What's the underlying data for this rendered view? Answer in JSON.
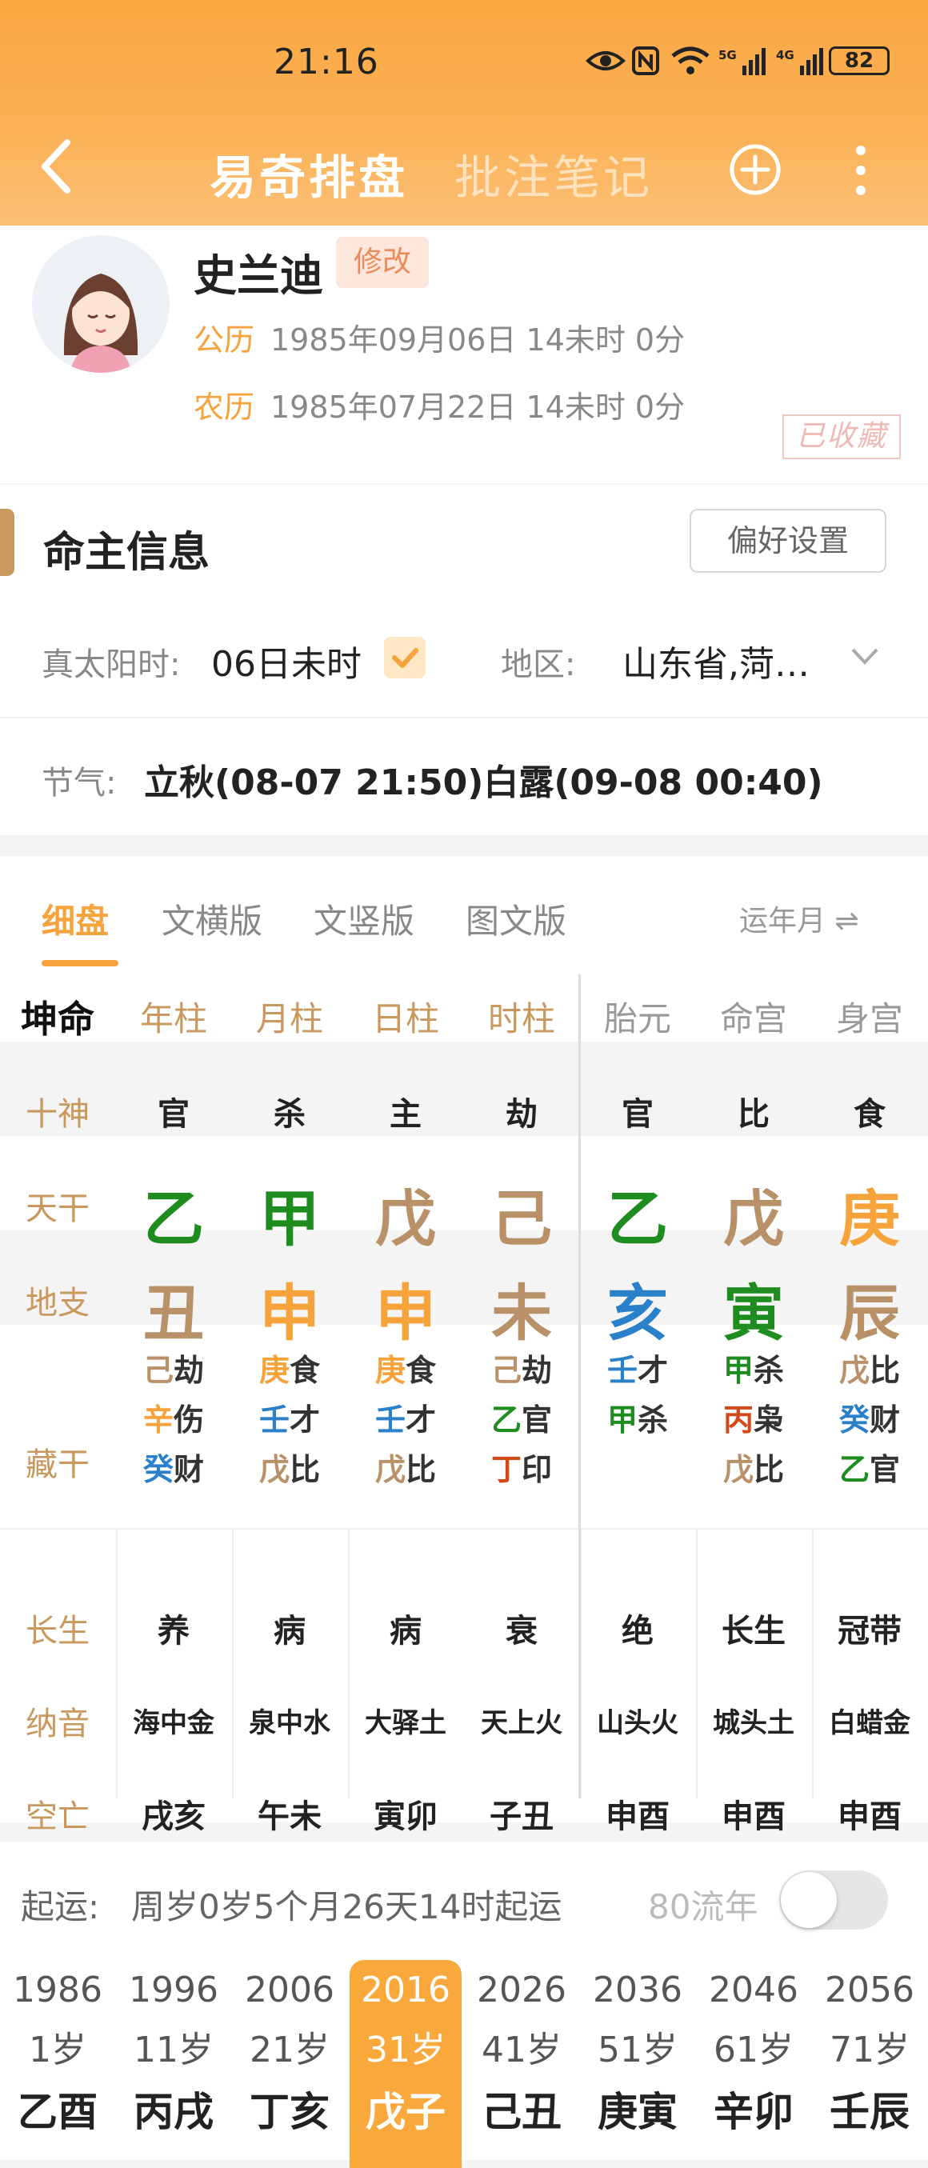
{
  "status": {
    "time": "21:16",
    "signal1": "5G",
    "signal2": "4G",
    "battery": "82"
  },
  "nav": {
    "title": "易奇排盘",
    "notes": "批注笔记"
  },
  "profile": {
    "name": "史兰迪",
    "edit": "修改",
    "solar_label": "公历",
    "solar": "1985年09月06日 14未时 0分",
    "lunar_label": "农历",
    "lunar": "1985年07月22日 14未时 0分",
    "stamp": "已收藏"
  },
  "info": {
    "title": "命主信息",
    "pref": "偏好设置",
    "sun_label": "真太阳时:",
    "sun_value": "06日未时",
    "region_label": "地区:",
    "region_value": "山东省,菏…",
    "jieqi_label": "节气:",
    "jieqi_value": "立秋(08-07 21:50)白露(09-08 00:40)"
  },
  "tabs": {
    "items": [
      "细盘",
      "文横版",
      "文竖版",
      "图文版"
    ],
    "active": 0,
    "right": "运年月 ⇌"
  },
  "colors": {
    "accent": "#f5a33a",
    "gold": "#c9985e",
    "wood": "#1e8c1e",
    "metal": "#f5a33a",
    "earth": "#b99168",
    "water": "#2a80c9",
    "fire": "#d24a1a"
  },
  "chart": {
    "gender": "坤命",
    "headers": [
      "年柱",
      "月柱",
      "日柱",
      "时柱",
      "胎元",
      "命宫",
      "身宫"
    ],
    "row_labels": [
      "十神",
      "天干",
      "地支",
      "藏干",
      "长生",
      "纳音",
      "空亡"
    ],
    "shishen": [
      "官",
      "杀",
      "主",
      "劫",
      "官",
      "比",
      "食"
    ],
    "tiangan": [
      {
        "c": "乙",
        "color": "#1e8c1e"
      },
      {
        "c": "甲",
        "color": "#1e8c1e"
      },
      {
        "c": "戊",
        "color": "#b99168"
      },
      {
        "c": "己",
        "color": "#b99168"
      },
      {
        "c": "乙",
        "color": "#1e8c1e"
      },
      {
        "c": "戊",
        "color": "#b99168"
      },
      {
        "c": "庚",
        "color": "#f5a33a"
      }
    ],
    "dizhi": [
      {
        "c": "丑",
        "color": "#b99168"
      },
      {
        "c": "申",
        "color": "#f5a33a"
      },
      {
        "c": "申",
        "color": "#f5a33a"
      },
      {
        "c": "未",
        "color": "#b99168"
      },
      {
        "c": "亥",
        "color": "#2a80c9"
      },
      {
        "c": "寅",
        "color": "#1e8c1e"
      },
      {
        "c": "辰",
        "color": "#b99168"
      }
    ],
    "canggan": [
      [
        {
          "g": "己",
          "color": "#b99168",
          "s": "劫"
        },
        {
          "g": "辛",
          "color": "#f5a33a",
          "s": "伤"
        },
        {
          "g": "癸",
          "color": "#2a80c9",
          "s": "财"
        }
      ],
      [
        {
          "g": "庚",
          "color": "#f5a33a",
          "s": "食"
        },
        {
          "g": "壬",
          "color": "#2a80c9",
          "s": "才"
        },
        {
          "g": "戊",
          "color": "#b99168",
          "s": "比"
        }
      ],
      [
        {
          "g": "庚",
          "color": "#f5a33a",
          "s": "食"
        },
        {
          "g": "壬",
          "color": "#2a80c9",
          "s": "才"
        },
        {
          "g": "戊",
          "color": "#b99168",
          "s": "比"
        }
      ],
      [
        {
          "g": "己",
          "color": "#b99168",
          "s": "劫"
        },
        {
          "g": "乙",
          "color": "#1e8c1e",
          "s": "官"
        },
        {
          "g": "丁",
          "color": "#d24a1a",
          "s": "印"
        }
      ],
      [
        {
          "g": "壬",
          "color": "#2a80c9",
          "s": "才"
        },
        {
          "g": "甲",
          "color": "#1e8c1e",
          "s": "杀"
        }
      ],
      [
        {
          "g": "甲",
          "color": "#1e8c1e",
          "s": "杀"
        },
        {
          "g": "丙",
          "color": "#d24a1a",
          "s": "枭"
        },
        {
          "g": "戊",
          "color": "#b99168",
          "s": "比"
        }
      ],
      [
        {
          "g": "戊",
          "color": "#b99168",
          "s": "比"
        },
        {
          "g": "癸",
          "color": "#2a80c9",
          "s": "财"
        },
        {
          "g": "乙",
          "color": "#1e8c1e",
          "s": "官"
        }
      ]
    ],
    "changsheng": [
      "养",
      "病",
      "病",
      "衰",
      "绝",
      "长生",
      "冠带"
    ],
    "nayin": [
      "海中金",
      "泉中水",
      "大驿土",
      "天上火",
      "山头火",
      "城头土",
      "白蜡金"
    ],
    "kongwang": [
      "戌亥",
      "午未",
      "寅卯",
      "子丑",
      "申酉",
      "申酉",
      "申酉"
    ]
  },
  "yun": {
    "label": "起运:",
    "value": "周岁0岁5个月26天14时起运",
    "toggle_label": "80流年",
    "toggle_on": false,
    "selected": 3,
    "dayun": [
      {
        "year": "1986",
        "age": "1岁",
        "gz": "乙酉"
      },
      {
        "year": "1996",
        "age": "11岁",
        "gz": "丙戌"
      },
      {
        "year": "2006",
        "age": "21岁",
        "gz": "丁亥"
      },
      {
        "year": "2016",
        "age": "31岁",
        "gz": "戊子"
      },
      {
        "year": "2026",
        "age": "41岁",
        "gz": "己丑"
      },
      {
        "year": "2036",
        "age": "51岁",
        "gz": "庚寅"
      },
      {
        "year": "2046",
        "age": "61岁",
        "gz": "辛卯"
      },
      {
        "year": "2056",
        "age": "71岁",
        "gz": "壬辰"
      }
    ]
  }
}
